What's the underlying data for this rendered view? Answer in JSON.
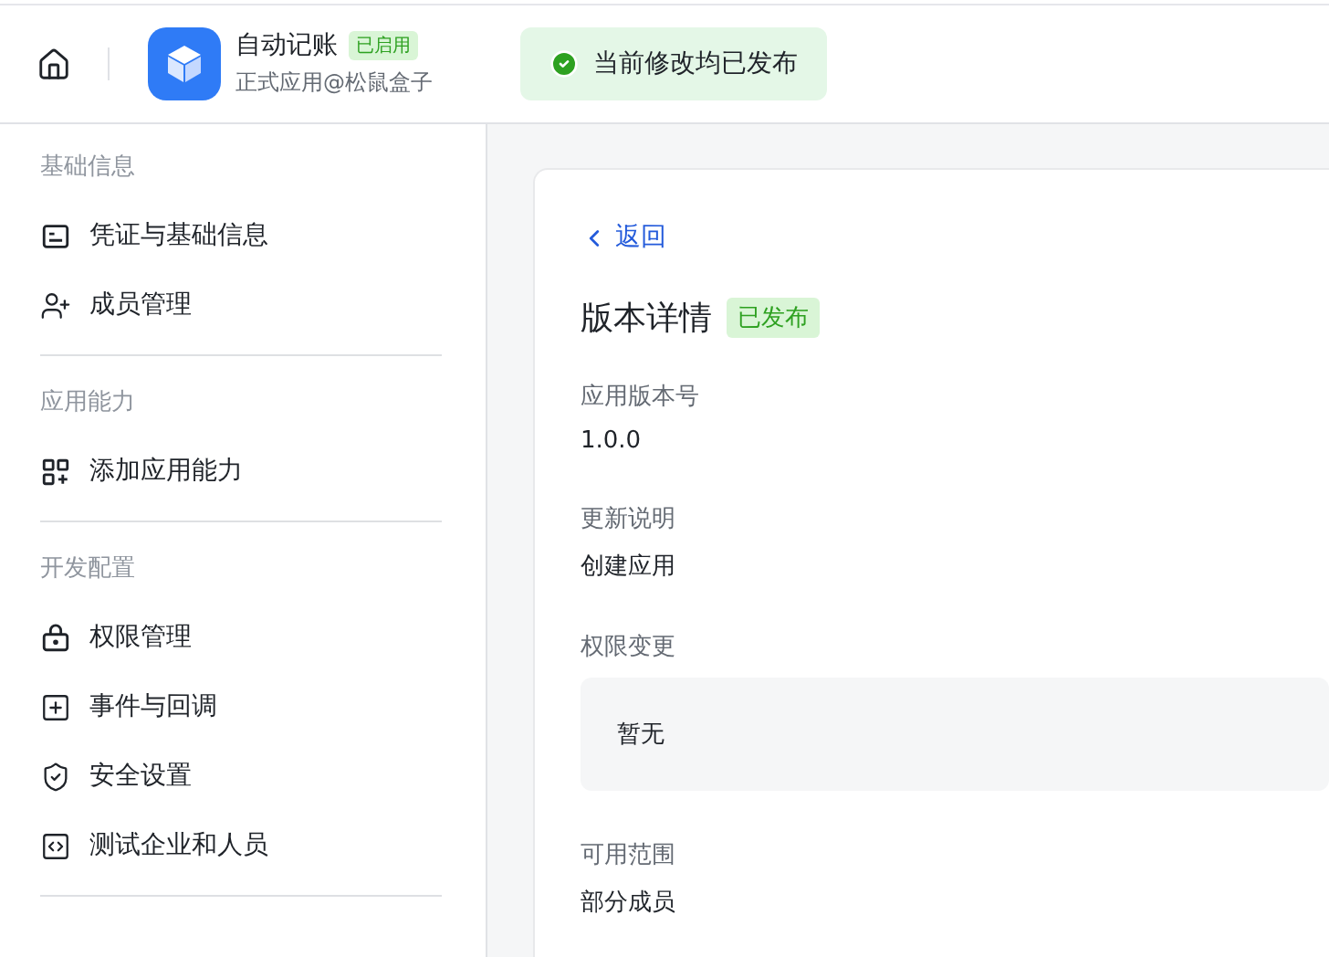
{
  "header": {
    "app_name": "自动记账",
    "app_status": "已启用",
    "app_subtitle": "正式应用@松鼠盒子",
    "toast": "当前修改均已发布"
  },
  "sidebar": {
    "sections": [
      {
        "title": "基础信息",
        "items": [
          {
            "kind": "credential",
            "label": "凭证与基础信息"
          },
          {
            "kind": "member",
            "label": "成员管理"
          }
        ]
      },
      {
        "title": "应用能力",
        "items": [
          {
            "kind": "capability",
            "label": "添加应用能力"
          }
        ]
      },
      {
        "title": "开发配置",
        "items": [
          {
            "kind": "permission",
            "label": "权限管理"
          },
          {
            "kind": "event",
            "label": "事件与回调"
          },
          {
            "kind": "security",
            "label": "安全设置"
          },
          {
            "kind": "test",
            "label": "测试企业和人员"
          }
        ]
      }
    ]
  },
  "detail": {
    "back": "返回",
    "title": "版本详情",
    "status": "已发布",
    "fields": [
      {
        "kind": "plain",
        "label": "应用版本号",
        "value": "1.0.0"
      },
      {
        "kind": "plain",
        "label": "更新说明",
        "value": "创建应用"
      },
      {
        "kind": "box",
        "label": "权限变更",
        "value": "暂无"
      },
      {
        "kind": "plain",
        "label": "可用范围",
        "value": "部分成员"
      }
    ]
  }
}
